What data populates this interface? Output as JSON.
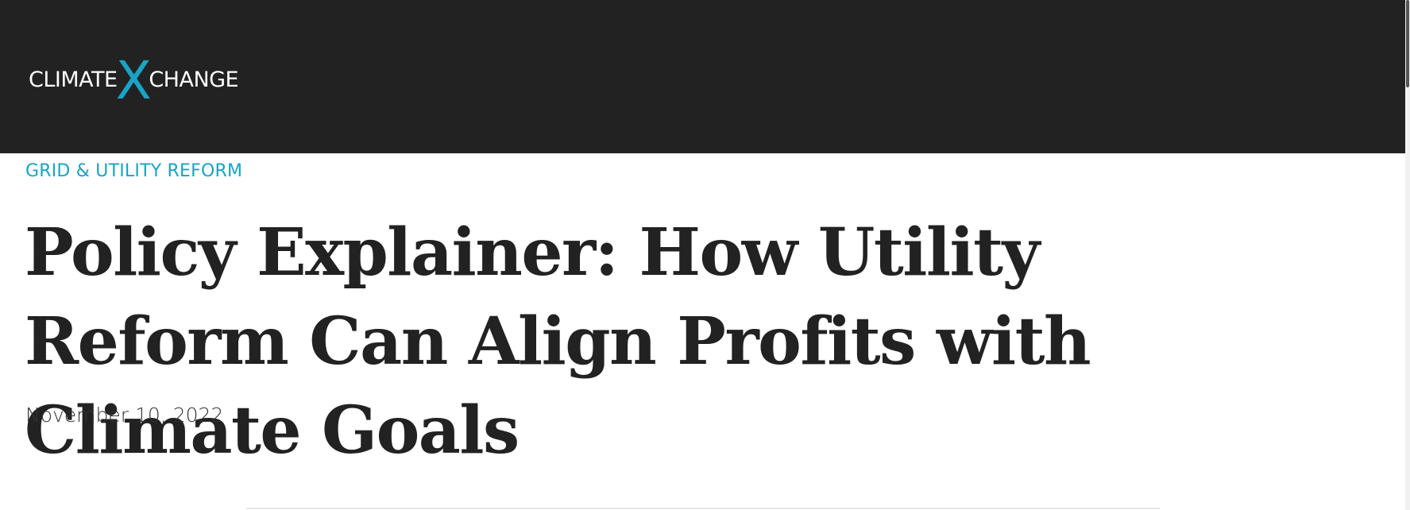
{
  "header": {
    "logo": {
      "left_text": "CLIMATE",
      "mark": "X",
      "right_text": "CHANGE"
    }
  },
  "article": {
    "category": "GRID & UTILITY REFORM",
    "title": "Policy Explainer: How Utility Reform Can Align Profits with Climate Goals",
    "date": "November 10, 2022"
  },
  "colors": {
    "header_bg": "#222222",
    "accent": "#1aa3c4",
    "title_text": "#222222"
  }
}
